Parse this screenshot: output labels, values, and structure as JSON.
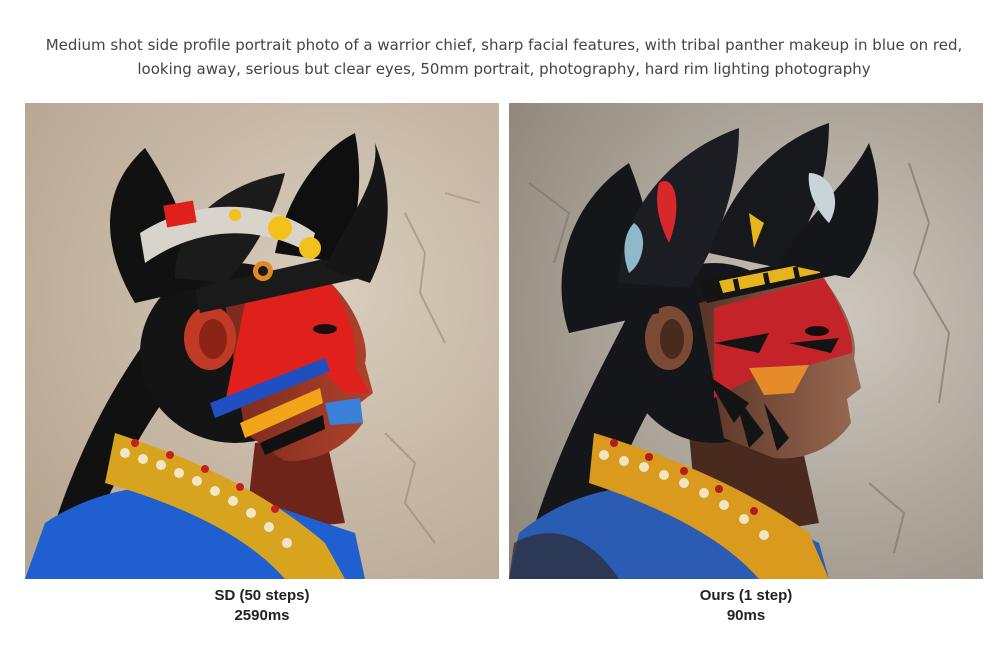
{
  "prompt": "Medium shot side profile portrait photo of a warrior chief, sharp facial features, with tribal panther makeup in blue on red, looking away, serious but clear eyes, 50mm portrait, photography, hard rim lighting photography",
  "panels": [
    {
      "method": "SD (50 steps)",
      "time": "2590ms",
      "colors": {
        "background": "#c7b8a6",
        "face_paint": "#e0201c",
        "garment": "#1f5fd0",
        "feathers": "#141414"
      }
    },
    {
      "method": "Ours (1 step)",
      "time": "90ms",
      "colors": {
        "background": "#b9b2a8",
        "face_paint": "#c4232a",
        "garment": "#2a5cb4",
        "feathers": "#1b1d22"
      }
    }
  ]
}
